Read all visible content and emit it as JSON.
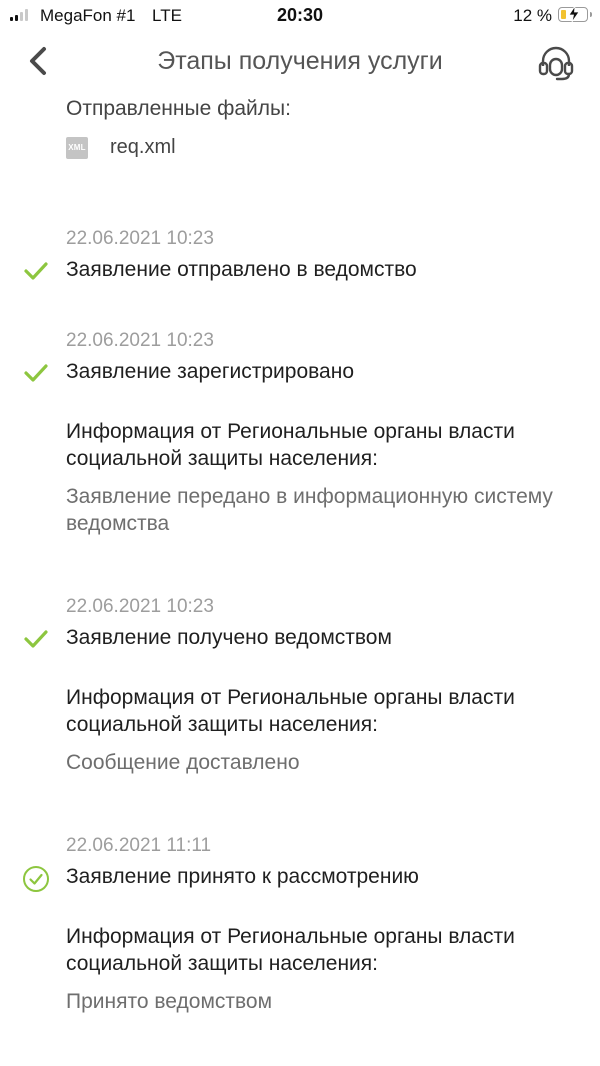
{
  "status_bar": {
    "carrier": "MegaFon #1",
    "network": "LTE",
    "time": "20:30",
    "battery": "12 %",
    "battery_level_percent": 12,
    "battery_color": "#f2c230"
  },
  "header": {
    "title": "Этапы получения услуги",
    "back_icon": "chevron-left-icon",
    "support_icon": "headset-icon"
  },
  "files": {
    "label": "Отправленные файлы:",
    "items": [
      {
        "icon_label": "XML",
        "name": "req.xml"
      }
    ]
  },
  "stages": [
    {
      "date": "22.06.2021 10:23",
      "title": "Заявление отправлено в ведомство",
      "status_icon": "check-icon"
    },
    {
      "date": "22.06.2021 10:23",
      "title": "Заявление зарегистрировано",
      "status_icon": "check-icon",
      "info_label": "Информация от Региональные органы власти социальной защиты населения:",
      "info_text": "Заявление передано в информационную систему ведомства"
    },
    {
      "date": "22.06.2021 10:23",
      "title": "Заявление получено ведомством",
      "status_icon": "check-icon",
      "info_label": "Информация от Региональные органы власти социальной защиты населения:",
      "info_text": "Сообщение доставлено"
    },
    {
      "date": "22.06.2021 11:11",
      "title": "Заявление принято к рассмотрению",
      "status_icon": "check-circle-icon",
      "info_label": "Информация от Региональные органы власти социальной защиты населения:",
      "info_text": "Принято ведомством"
    }
  ],
  "colors": {
    "accent_green": "#8dc63f",
    "date_gray": "#9d9d9d",
    "icon_gray": "#4a4a4a"
  }
}
